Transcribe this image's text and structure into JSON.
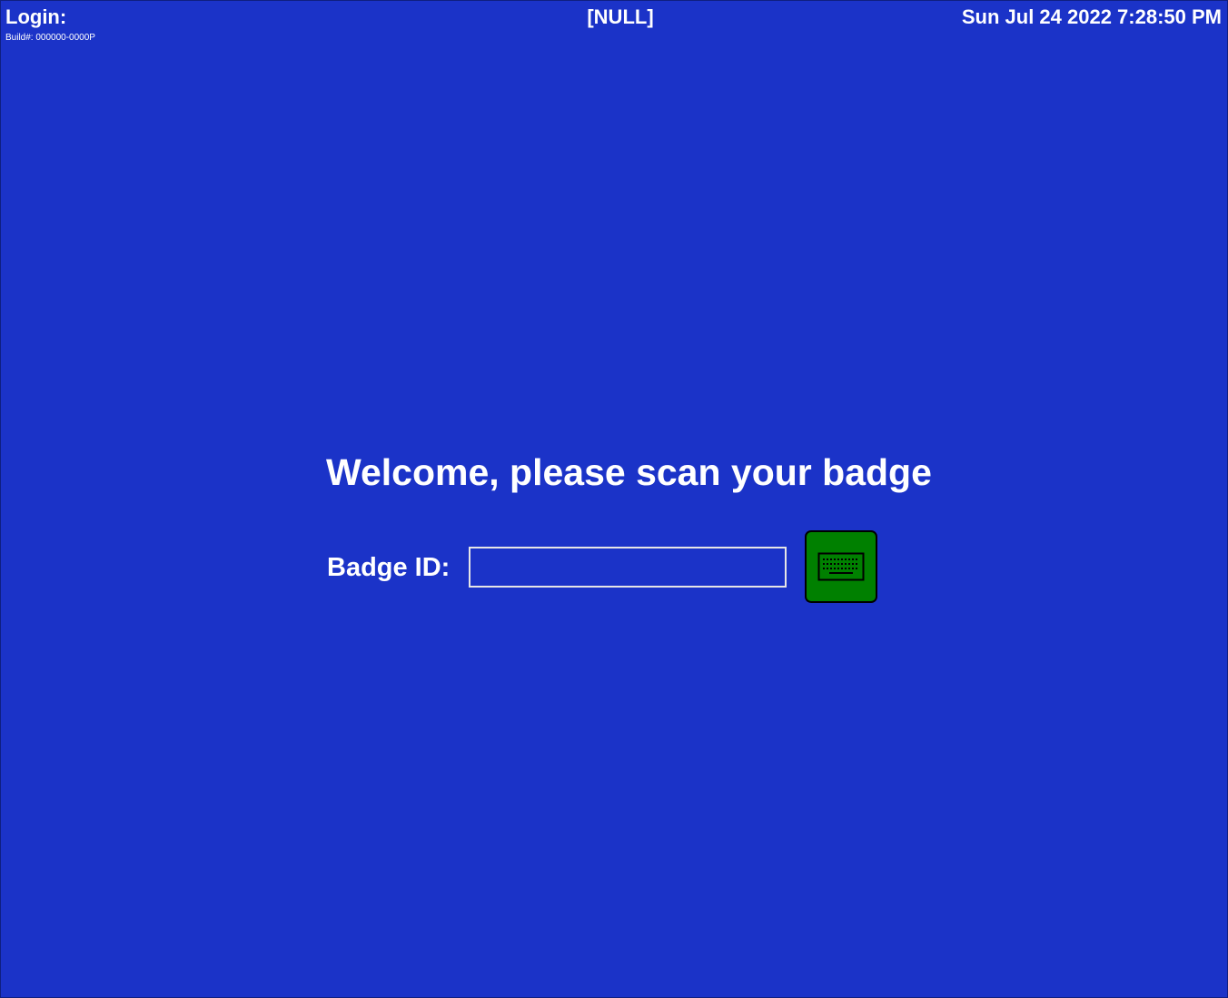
{
  "header": {
    "screen_title": "Login:",
    "build": "Build#: 000000-0000P",
    "station": "[NULL]",
    "datetime": "Sun Jul 24 2022 7:28:50 PM"
  },
  "login": {
    "welcome": "Welcome, please scan your badge",
    "badge_label": "Badge ID:",
    "badge_value": "",
    "keyboard_button_icon": "keyboard-icon"
  },
  "colors": {
    "background": "#1b33c8",
    "keyboard_button": "#008000",
    "text": "#ffffff"
  }
}
